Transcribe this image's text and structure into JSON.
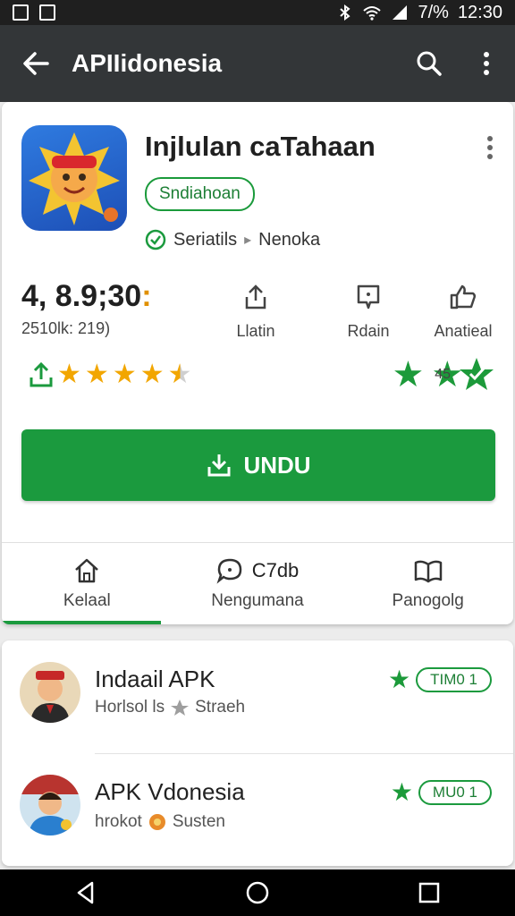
{
  "status_bar": {
    "battery": "7/%",
    "time": "12:30"
  },
  "app_bar": {
    "title": "APIIidonesia"
  },
  "app": {
    "title": "Injlulan caTahaan",
    "chip": "Sndiahoan",
    "verified_label": "Seriatils",
    "developer": "Nenoka"
  },
  "stats": {
    "rating_value": "4, 8.9;30",
    "rating_dot": ":",
    "rating_sub": "2510lk: 219)",
    "share_label": "Llatin",
    "review_label": "Rdain",
    "badge_label": "Anatieal"
  },
  "stars_right_label": "45",
  "install_label": "UNDU",
  "tabs": [
    {
      "label": "Kelaal",
      "top_label": ""
    },
    {
      "label": "Nengumana",
      "top_label": "C7db"
    },
    {
      "label": "Panogolg",
      "top_label": ""
    }
  ],
  "list": [
    {
      "name": "Indaail APK",
      "sub_a": "Horlsol ls",
      "sub_b": "Straeh",
      "badge": "TIM0 1"
    },
    {
      "name": "APK Vdonesia",
      "sub_a": "hrokot",
      "sub_b": "Susten",
      "badge": "MU0 1"
    }
  ],
  "colors": {
    "brand_green": "#1b9a3e",
    "appbar": "#333638",
    "star_yellow": "#f2a600"
  }
}
